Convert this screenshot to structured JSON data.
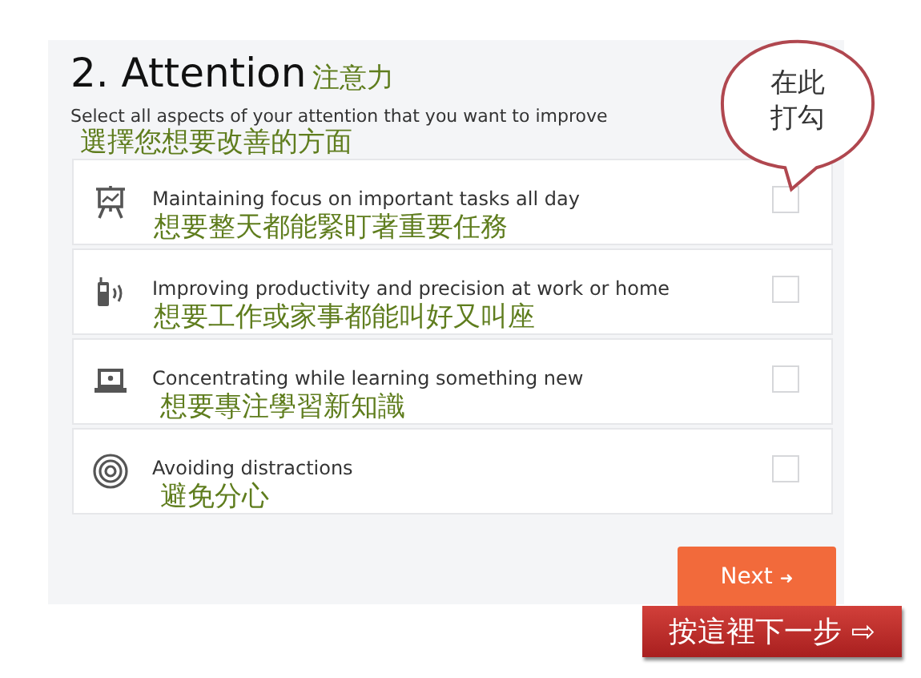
{
  "header": {
    "title": "2. Attention",
    "title_note": "注意力",
    "subtitle": "Select all aspects of your attention that you want to improve",
    "subtitle_note": "選擇您想要改善的方面"
  },
  "options": [
    {
      "kind": "presentation",
      "label": "Maintaining focus on important tasks all day",
      "note": "想要整天都能緊盯著重要任務",
      "checked": false
    },
    {
      "kind": "phone",
      "label": "Improving productivity and precision at work or home",
      "note": "想要工作或家事都能叫好又叫座",
      "checked": false
    },
    {
      "kind": "laptop",
      "label": "Concentrating while learning something new",
      "note": "想要專注學習新知識",
      "checked": false
    },
    {
      "kind": "target",
      "label": "Avoiding distractions",
      "note": "避免分心",
      "checked": false
    }
  ],
  "callout": {
    "lines": [
      "在此",
      "打勾"
    ]
  },
  "next_button": {
    "label": "Next",
    "icon": "➜"
  },
  "next_note": {
    "label": "按這裡下一步 ⇨"
  }
}
